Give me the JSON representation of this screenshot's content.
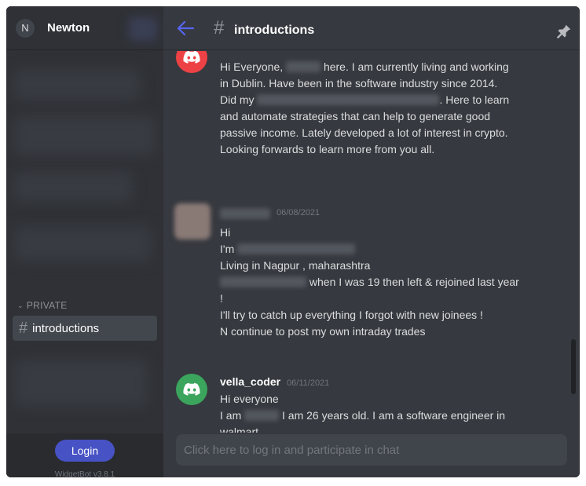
{
  "server": {
    "name": "Newton",
    "avatar_letter": "N"
  },
  "sidebar": {
    "category": "PRIVATE",
    "channels": [
      {
        "name": "introductions",
        "active": true
      }
    ]
  },
  "footer": {
    "login_label": "Login",
    "version": "WidgetBot v3.8.1"
  },
  "header": {
    "channel_name": "introductions"
  },
  "messages": [
    {
      "avatar": "discord-icon",
      "lines": [
        "Hi Everyone,",
        "here. I am currently living and working",
        "in Dublin. Have been in the software industry since 2014.",
        "Did my",
        ". Here to learn",
        "and automate strategies that can help to generate good",
        "passive income. Lately developed a lot of interest in crypto.",
        "Looking forwards to learn more from you all."
      ]
    },
    {
      "timestamp": "06/08/2021",
      "lines": [
        "Hi",
        "I'm",
        "Living in Nagpur , maharashtra",
        "when I was 19 then left & rejoined last year",
        "!",
        "I'll try to catch up everything I forgot with new joinees !",
        "N continue to post my own intraday trades"
      ]
    },
    {
      "author": "vella_coder",
      "timestamp": "06/11/2021",
      "avatar": "discord-icon",
      "lines": [
        "Hi everyone",
        "I am",
        "I am 26 years old. I am  a software engineer in",
        "walmart."
      ]
    }
  ],
  "composer": {
    "placeholder": "Click here to log in and participate in chat"
  },
  "colors": {
    "accent": "#5865f2",
    "avatar_red": "#ed4245",
    "avatar_green": "#3ba55d",
    "login": "#4752c4"
  }
}
